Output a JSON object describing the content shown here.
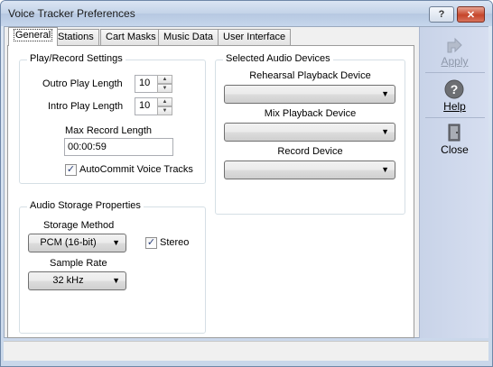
{
  "window": {
    "title": "Voice Tracker Preferences",
    "help_glyph": "?",
    "close_glyph": "✕"
  },
  "tabs": [
    {
      "label": "General"
    },
    {
      "label": "Stations"
    },
    {
      "label": "Cart Masks"
    },
    {
      "label": "Music Data"
    },
    {
      "label": "User Interface"
    }
  ],
  "play_record": {
    "title": "Play/Record Settings",
    "outro_label": "Outro Play Length",
    "outro_value": "10",
    "intro_label": "Intro Play Length",
    "intro_value": "10",
    "max_record_label": "Max Record Length",
    "max_record_value": "00:00:59",
    "autocommit_label": "AutoCommit Voice Tracks",
    "autocommit_checked": true
  },
  "audio_devices": {
    "title": "Selected Audio Devices",
    "rehearsal_label": "Rehearsal Playback Device",
    "rehearsal_value": "",
    "mix_label": "Mix Playback Device",
    "mix_value": "",
    "record_label": "Record Device",
    "record_value": ""
  },
  "storage": {
    "title": "Audio Storage Properties",
    "method_label": "Storage Method",
    "method_value": "PCM (16-bit)",
    "stereo_label": "Stereo",
    "stereo_checked": true,
    "rate_label": "Sample Rate",
    "rate_value": "32 kHz"
  },
  "sidebar": {
    "apply": {
      "label": "Apply",
      "icon": "apply-icon",
      "enabled": false
    },
    "help": {
      "label": "Help",
      "icon": "help-icon",
      "enabled": true
    },
    "close": {
      "label": "Close",
      "icon": "door-icon",
      "enabled": true
    }
  },
  "glyphs": {
    "check": "✓",
    "arrow_down": "▼",
    "spin_up": "▲",
    "spin_down": "▼"
  }
}
